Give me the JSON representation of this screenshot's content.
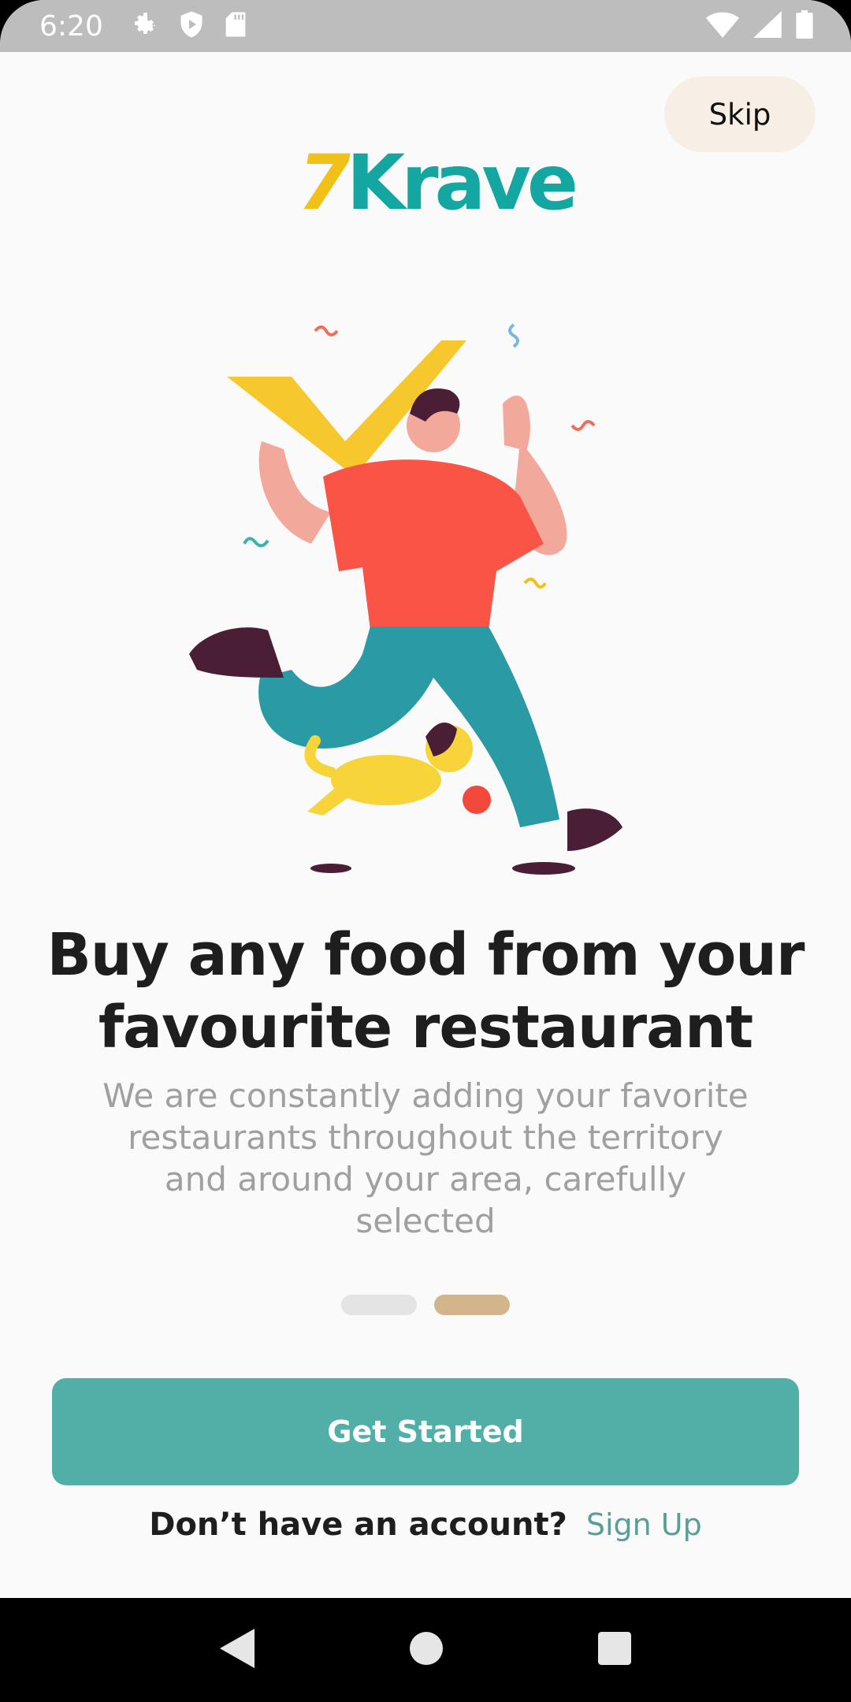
{
  "status_bar": {
    "time": "6:20",
    "icons": [
      "settings-icon",
      "shield-play-icon",
      "sd-card-icon",
      "wifi-icon",
      "signal-icon",
      "battery-icon"
    ]
  },
  "header": {
    "skip_label": "Skip",
    "logo_seven": "7",
    "logo_text": "Krave"
  },
  "onboarding": {
    "title": "Buy any food from your favourite restaurant",
    "description": "We are constantly adding your favorite restaurants throughout the territory and around your area, carefully selected",
    "page_indicator": {
      "total": 2,
      "active": 2
    }
  },
  "actions": {
    "get_started_label": "Get Started",
    "signup_prompt": "Don’t have an account?",
    "signup_link": "Sign Up"
  },
  "nav": {
    "icons": [
      "back-icon",
      "home-icon",
      "recents-icon"
    ]
  },
  "colors": {
    "brand_teal": "#52AFA8",
    "logo_yellow": "#F2C117",
    "logo_teal": "#14A6A0",
    "indicator_active": "#D2B58A",
    "skip_bg": "#F7EFE6"
  }
}
